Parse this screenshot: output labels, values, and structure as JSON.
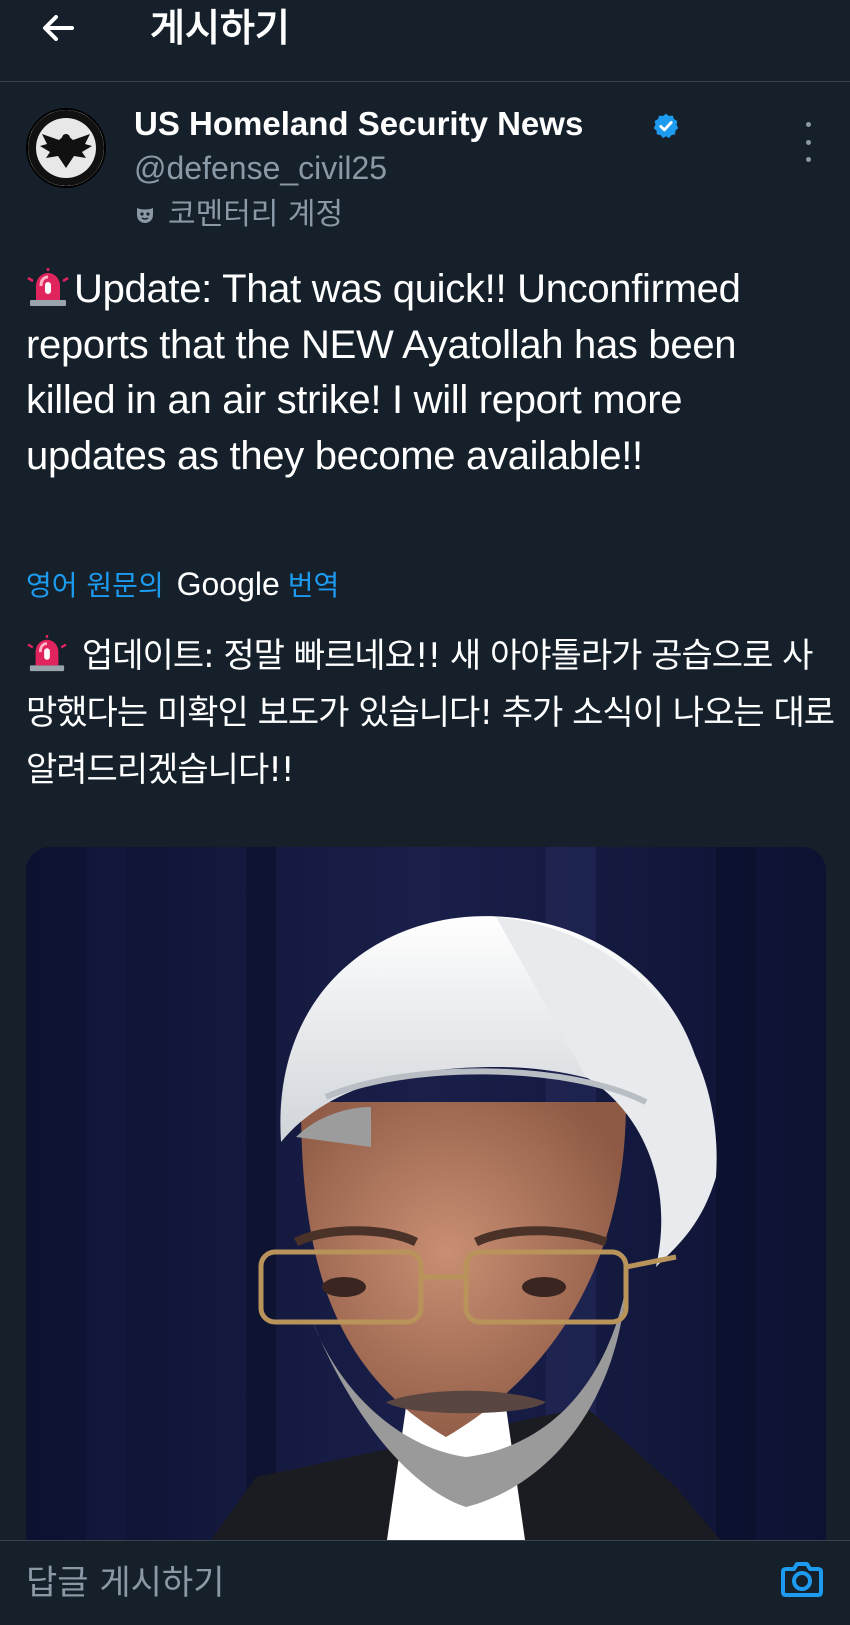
{
  "header": {
    "title": "게시하기"
  },
  "author": {
    "display_name": "US Homeland Security News",
    "handle": "@defense_civil25",
    "account_label": "코멘터리 계정",
    "verified": true
  },
  "tweet": {
    "text": "Update: That was quick!! Unconfirmed reports that the NEW Ayatollah has been killed in an air strike! I will report more updates as they become available!!"
  },
  "translation": {
    "prefix": "영어 원문의",
    "provider": "Google",
    "suffix": "번역",
    "text": "업데이트: 정말 빠르네요!! 새 아야톨라가 공습으로 사망했다는 미확인 보도가 있습니다! 추가 소식이 나오는 대로 알려드리겠습니다!!"
  },
  "reply": {
    "placeholder": "답글 게시하기"
  },
  "icons": {
    "back": "arrow-left-icon",
    "verified": "verified-badge-icon",
    "more": "more-vertical-icon",
    "siren": "police-siren-emoji",
    "camera": "camera-icon"
  },
  "colors": {
    "background": "#15202b",
    "accent": "#1d9bf0",
    "secondary_text": "#8b98a5"
  }
}
